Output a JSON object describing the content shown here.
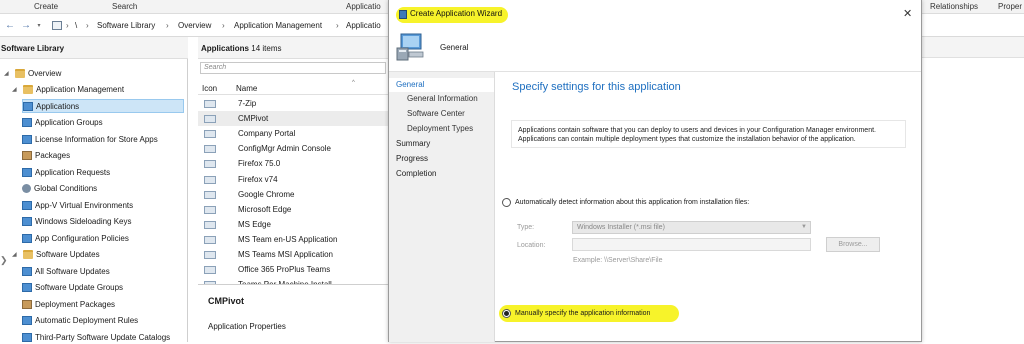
{
  "ribbon": {
    "items": [
      "Create",
      "Search",
      "Applicatio",
      "Relationships",
      "Proper"
    ]
  },
  "address": {
    "back_icon": "back-arrow-icon",
    "forward_icon": "forward-arrow-icon",
    "breadcrumbs": [
      "\\",
      "Software Library",
      "Overview",
      "Application Management",
      "Applicatio"
    ]
  },
  "nav": {
    "title": "Software Library",
    "items": [
      {
        "label": "Overview",
        "level": 0,
        "icon": "folder-icon"
      },
      {
        "label": "Application Management",
        "level": 1,
        "icon": "folder-icon"
      },
      {
        "label": "Applications",
        "level": 2,
        "icon": "application-icon",
        "selected": true
      },
      {
        "label": "Application Groups",
        "level": 2,
        "icon": "application-icon"
      },
      {
        "label": "License Information for Store Apps",
        "level": 2,
        "icon": "application-icon"
      },
      {
        "label": "Packages",
        "level": 2,
        "icon": "package-icon"
      },
      {
        "label": "Application Requests",
        "level": 2,
        "icon": "application-icon"
      },
      {
        "label": "Global Conditions",
        "level": 2,
        "icon": "gear-icon"
      },
      {
        "label": "App-V Virtual Environments",
        "level": 2,
        "icon": "application-icon"
      },
      {
        "label": "Windows Sideloading Keys",
        "level": 2,
        "icon": "application-icon"
      },
      {
        "label": "App Configuration Policies",
        "level": 2,
        "icon": "application-icon"
      },
      {
        "label": "Software Updates",
        "level": 1,
        "icon": "folder-icon"
      },
      {
        "label": "All Software Updates",
        "level": 2,
        "icon": "application-icon"
      },
      {
        "label": "Software Update Groups",
        "level": 2,
        "icon": "application-icon"
      },
      {
        "label": "Deployment Packages",
        "level": 2,
        "icon": "package-icon"
      },
      {
        "label": "Automatic Deployment Rules",
        "level": 2,
        "icon": "application-icon"
      },
      {
        "label": "Third-Party Software Update Catalogs",
        "level": 2,
        "icon": "application-icon"
      }
    ]
  },
  "list": {
    "title": "Applications",
    "count": "14 items",
    "search_placeholder": "Search",
    "columns": [
      "Icon",
      "Name"
    ],
    "rows": [
      "7-Zip",
      "CMPivot",
      "Company Portal",
      "ConfigMgr Admin Console",
      "Firefox 75.0",
      "Firefox v74",
      "Google Chrome",
      "Microsoft Edge",
      "MS Edge",
      "MS Team en-US Application",
      "MS Teams MSI Application",
      "Office 365 ProPlus Teams",
      "Teams Per Machine Install"
    ],
    "selected_row": "CMPivot",
    "detail_title": "CMPivot",
    "detail_subtitle": "Application Properties"
  },
  "wizard": {
    "title": "Create Application Wizard",
    "close_label": "✕",
    "header_label": "General",
    "steps": [
      {
        "label": "General",
        "type": "active"
      },
      {
        "label": "General Information",
        "type": "sub"
      },
      {
        "label": "Software Center",
        "type": "sub"
      },
      {
        "label": "Deployment Types",
        "type": "sub"
      },
      {
        "label": "Summary",
        "type": "top"
      },
      {
        "label": "Progress",
        "type": "top"
      },
      {
        "label": "Completion",
        "type": "top"
      }
    ],
    "heading": "Specify settings for this application",
    "description": "Applications contain software that you can deploy to users and devices in your Configuration Manager environment. Applications can contain multiple deployment types that customize the installation behavior of the application.",
    "auto_option": "Automatically detect information about this application from installation files:",
    "type_label": "Type:",
    "type_value": "Windows Installer (*.msi file)",
    "location_label": "Location:",
    "browse_label": "Browse...",
    "example_text": "Example:  \\\\Server\\Share\\File",
    "manual_option": "Manually specify the application information"
  },
  "colors": {
    "highlight": "#f7f32a",
    "accent": "#1e6fc0",
    "selection": "#cde5f7"
  }
}
